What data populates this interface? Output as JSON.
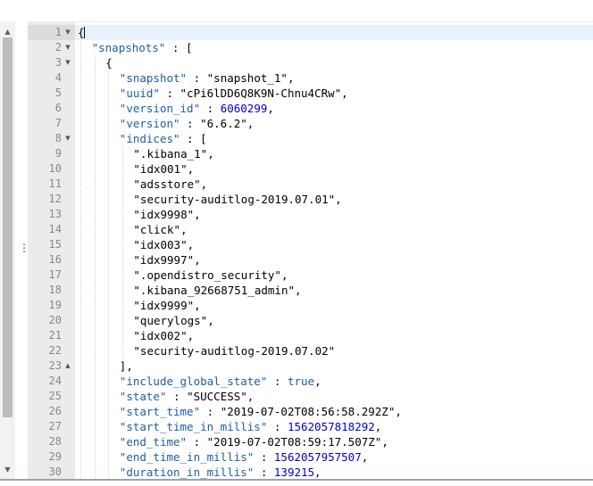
{
  "editor": {
    "lines": [
      {
        "n": "1",
        "fold": "▼",
        "indent": 0,
        "parts": [
          [
            "p",
            "{"
          ]
        ]
      },
      {
        "n": "2",
        "fold": "▼",
        "indent": 1,
        "parts": [
          [
            "k",
            "\"snapshots\""
          ],
          [
            "p",
            " : ["
          ]
        ]
      },
      {
        "n": "3",
        "fold": "▼",
        "indent": 2,
        "parts": [
          [
            "p",
            "{"
          ]
        ]
      },
      {
        "n": "4",
        "fold": "",
        "indent": 3,
        "parts": [
          [
            "k",
            "\"snapshot\""
          ],
          [
            "p",
            " : "
          ],
          [
            "s",
            "\"snapshot_1\""
          ],
          [
            "p",
            ","
          ]
        ]
      },
      {
        "n": "5",
        "fold": "",
        "indent": 3,
        "parts": [
          [
            "k",
            "\"uuid\""
          ],
          [
            "p",
            " : "
          ],
          [
            "s",
            "\"cPi6lDD6Q8K9N-Chnu4CRw\""
          ],
          [
            "p",
            ","
          ]
        ]
      },
      {
        "n": "6",
        "fold": "",
        "indent": 3,
        "parts": [
          [
            "k",
            "\"version_id\""
          ],
          [
            "p",
            " : "
          ],
          [
            "n",
            "6060299"
          ],
          [
            "p",
            ","
          ]
        ]
      },
      {
        "n": "7",
        "fold": "",
        "indent": 3,
        "parts": [
          [
            "k",
            "\"version\""
          ],
          [
            "p",
            " : "
          ],
          [
            "s",
            "\"6.6.2\""
          ],
          [
            "p",
            ","
          ]
        ]
      },
      {
        "n": "8",
        "fold": "▼",
        "indent": 3,
        "parts": [
          [
            "k",
            "\"indices\""
          ],
          [
            "p",
            " : ["
          ]
        ]
      },
      {
        "n": "9",
        "fold": "",
        "indent": 4,
        "parts": [
          [
            "s",
            "\".kibana_1\""
          ],
          [
            "p",
            ","
          ]
        ]
      },
      {
        "n": "10",
        "fold": "",
        "indent": 4,
        "parts": [
          [
            "s",
            "\"idx001\""
          ],
          [
            "p",
            ","
          ]
        ]
      },
      {
        "n": "11",
        "fold": "",
        "indent": 4,
        "parts": [
          [
            "s",
            "\"adsstore\""
          ],
          [
            "p",
            ","
          ]
        ]
      },
      {
        "n": "12",
        "fold": "",
        "indent": 4,
        "parts": [
          [
            "s",
            "\"security-auditlog-2019.07.01\""
          ],
          [
            "p",
            ","
          ]
        ]
      },
      {
        "n": "13",
        "fold": "",
        "indent": 4,
        "parts": [
          [
            "s",
            "\"idx9998\""
          ],
          [
            "p",
            ","
          ]
        ]
      },
      {
        "n": "14",
        "fold": "",
        "indent": 4,
        "parts": [
          [
            "s",
            "\"click\""
          ],
          [
            "p",
            ","
          ]
        ]
      },
      {
        "n": "15",
        "fold": "",
        "indent": 4,
        "parts": [
          [
            "s",
            "\"idx003\""
          ],
          [
            "p",
            ","
          ]
        ]
      },
      {
        "n": "16",
        "fold": "",
        "indent": 4,
        "parts": [
          [
            "s",
            "\"idx9997\""
          ],
          [
            "p",
            ","
          ]
        ]
      },
      {
        "n": "17",
        "fold": "",
        "indent": 4,
        "parts": [
          [
            "s",
            "\".opendistro_security\""
          ],
          [
            "p",
            ","
          ]
        ]
      },
      {
        "n": "18",
        "fold": "",
        "indent": 4,
        "parts": [
          [
            "s",
            "\".kibana_92668751_admin\""
          ],
          [
            "p",
            ","
          ]
        ]
      },
      {
        "n": "19",
        "fold": "",
        "indent": 4,
        "parts": [
          [
            "s",
            "\"idx9999\""
          ],
          [
            "p",
            ","
          ]
        ]
      },
      {
        "n": "20",
        "fold": "",
        "indent": 4,
        "parts": [
          [
            "s",
            "\"querylogs\""
          ],
          [
            "p",
            ","
          ]
        ]
      },
      {
        "n": "21",
        "fold": "",
        "indent": 4,
        "parts": [
          [
            "s",
            "\"idx002\""
          ],
          [
            "p",
            ","
          ]
        ]
      },
      {
        "n": "22",
        "fold": "",
        "indent": 4,
        "parts": [
          [
            "s",
            "\"security-auditlog-2019.07.02\""
          ]
        ]
      },
      {
        "n": "23",
        "fold": "▲",
        "indent": 3,
        "parts": [
          [
            "p",
            "],"
          ]
        ]
      },
      {
        "n": "24",
        "fold": "",
        "indent": 3,
        "parts": [
          [
            "k",
            "\"include_global_state\""
          ],
          [
            "p",
            " : "
          ],
          [
            "b",
            "true"
          ],
          [
            "p",
            ","
          ]
        ]
      },
      {
        "n": "25",
        "fold": "",
        "indent": 3,
        "parts": [
          [
            "k",
            "\"state\""
          ],
          [
            "p",
            " : "
          ],
          [
            "s",
            "\"SUCCESS\""
          ],
          [
            "p",
            ","
          ]
        ]
      },
      {
        "n": "26",
        "fold": "",
        "indent": 3,
        "parts": [
          [
            "k",
            "\"start_time\""
          ],
          [
            "p",
            " : "
          ],
          [
            "s",
            "\"2019-07-02T08:56:58.292Z\""
          ],
          [
            "p",
            ","
          ]
        ]
      },
      {
        "n": "27",
        "fold": "",
        "indent": 3,
        "parts": [
          [
            "k",
            "\"start_time_in_millis\""
          ],
          [
            "p",
            " : "
          ],
          [
            "n",
            "1562057818292"
          ],
          [
            "p",
            ","
          ]
        ]
      },
      {
        "n": "28",
        "fold": "",
        "indent": 3,
        "parts": [
          [
            "k",
            "\"end_time\""
          ],
          [
            "p",
            " : "
          ],
          [
            "s",
            "\"2019-07-02T08:59:17.507Z\""
          ],
          [
            "p",
            ","
          ]
        ]
      },
      {
        "n": "29",
        "fold": "",
        "indent": 3,
        "parts": [
          [
            "k",
            "\"end_time_in_millis\""
          ],
          [
            "p",
            " : "
          ],
          [
            "n",
            "1562057957507"
          ],
          [
            "p",
            ","
          ]
        ]
      },
      {
        "n": "30",
        "fold": "",
        "indent": 3,
        "parts": [
          [
            "k",
            "\"duration_in_millis\""
          ],
          [
            "p",
            " : "
          ],
          [
            "n",
            "139215"
          ],
          [
            "p",
            ","
          ]
        ]
      }
    ]
  },
  "scrollbar": {
    "up_arrow": "▲",
    "down_arrow": "▼"
  },
  "splitter": {
    "grip": "⋮"
  },
  "colors": {
    "key": "#1e5dab",
    "number": "#0000dd",
    "string": "#000000",
    "active_line": "#e8f2ff"
  }
}
